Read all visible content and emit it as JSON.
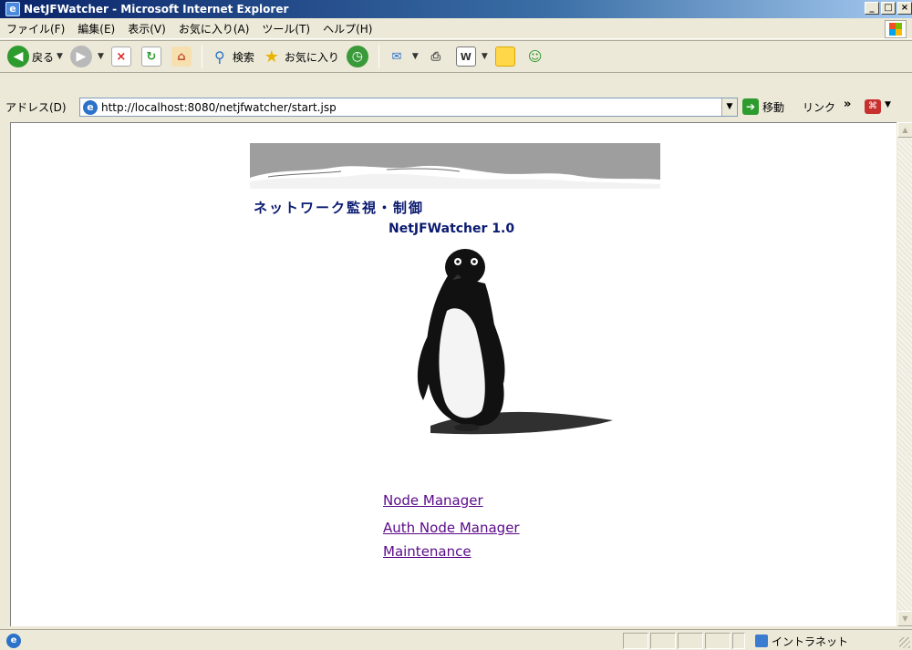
{
  "window": {
    "title": "NetJFWatcher - Microsoft Internet Explorer"
  },
  "menu": [
    "ファイル(F)",
    "編集(E)",
    "表示(V)",
    "お気に入り(A)",
    "ツール(T)",
    "ヘルプ(H)"
  ],
  "toolbar": {
    "back": "戻る",
    "search": "検索",
    "favorites": "お気に入り"
  },
  "address": {
    "label": "アドレス(D)",
    "url": "http://localhost:8080/netjfwatcher/start.jsp",
    "go": "移動",
    "links": "リンク",
    "more": "»"
  },
  "page": {
    "heading_jp": "ネットワーク監視・制御",
    "heading_en": "NetJFWatcher 1.0",
    "links": [
      "Node Manager",
      "Auth Node Manager",
      "Maintenance"
    ]
  },
  "status": {
    "zone": "イントラネット"
  },
  "colors": {
    "heading": "#0a1a70",
    "link_visited": "#5a0a8a",
    "titlebar": "#0a246a"
  }
}
